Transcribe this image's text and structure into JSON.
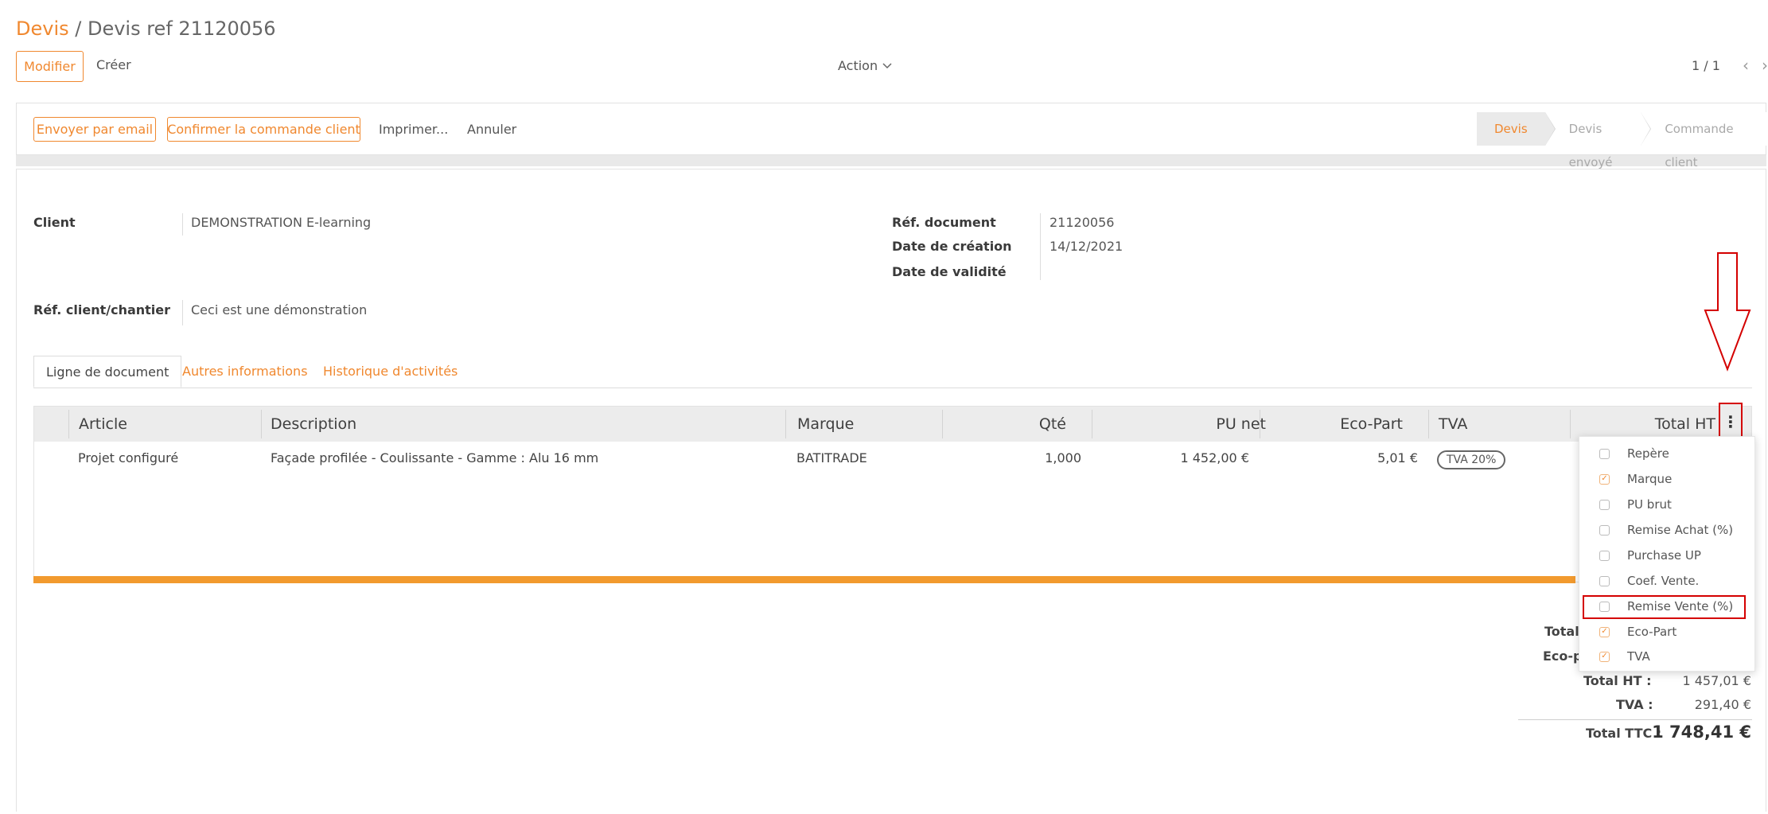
{
  "breadcrumb": {
    "root": "Devis",
    "separator": " / ",
    "current": "Devis ref 21120056"
  },
  "toolbar": {
    "edit_label": "Modifier",
    "create_label": "Créer",
    "action_label": "Action",
    "pager": "1 / 1"
  },
  "statusbar": {
    "email_label": "Envoyer par email",
    "confirm_label": "Confirmer la commande client",
    "print_label": "Imprimer...",
    "cancel_label": "Annuler",
    "stages": [
      "Devis",
      "Devis envoyé",
      "Commande client"
    ]
  },
  "form": {
    "client_label": "Client",
    "client_value": "DEMONSTRATION E-learning",
    "ref_client_label": "Réf. client/chantier",
    "ref_client_value": "Ceci est une démonstration",
    "ref_doc_label": "Réf. document",
    "ref_doc_value": "21120056",
    "date_creation_label": "Date de création",
    "date_creation_value": "14/12/2021",
    "date_validite_label": "Date de validité"
  },
  "tabs": [
    "Ligne de document",
    "Autres informations",
    "Historique d'activités"
  ],
  "table": {
    "headers": [
      "Article",
      "Description",
      "Marque",
      "Qté",
      "PU net",
      "Eco-Part",
      "TVA",
      "Total HT"
    ],
    "row": {
      "article": "Projet configuré",
      "description": "Façade profilée - Coulissante - Gamme : Alu 16 mm",
      "marque": "BATITRADE",
      "qte": "1,000",
      "pu_net": "1 452,00 €",
      "eco_part": "5,01 €",
      "tva": "TVA 20%"
    }
  },
  "column_menu": [
    {
      "label": "Repère",
      "checked": false
    },
    {
      "label": "Marque",
      "checked": true
    },
    {
      "label": "PU brut",
      "checked": false
    },
    {
      "label": "Remise Achat (%)",
      "checked": false
    },
    {
      "label": "Purchase UP",
      "checked": false
    },
    {
      "label": "Coef. Vente.",
      "checked": false
    },
    {
      "label": "Remise Vente (%)",
      "checked": false
    },
    {
      "label": "Eco-Part",
      "checked": true
    },
    {
      "label": "TVA",
      "checked": true
    }
  ],
  "totals": {
    "total_partial": "Total",
    "eco_partial": "Eco-pa",
    "total_ht_label": "Total HT :",
    "total_ht_value": "1 457,01 €",
    "tva_label": "TVA :",
    "tva_value": "291,40 €",
    "ttc_label": "Total TTC :",
    "ttc_value": "1 748,41 €"
  },
  "colors": {
    "accent": "#f0882f",
    "highlight": "#d40000",
    "progress": "#f29a2e"
  }
}
